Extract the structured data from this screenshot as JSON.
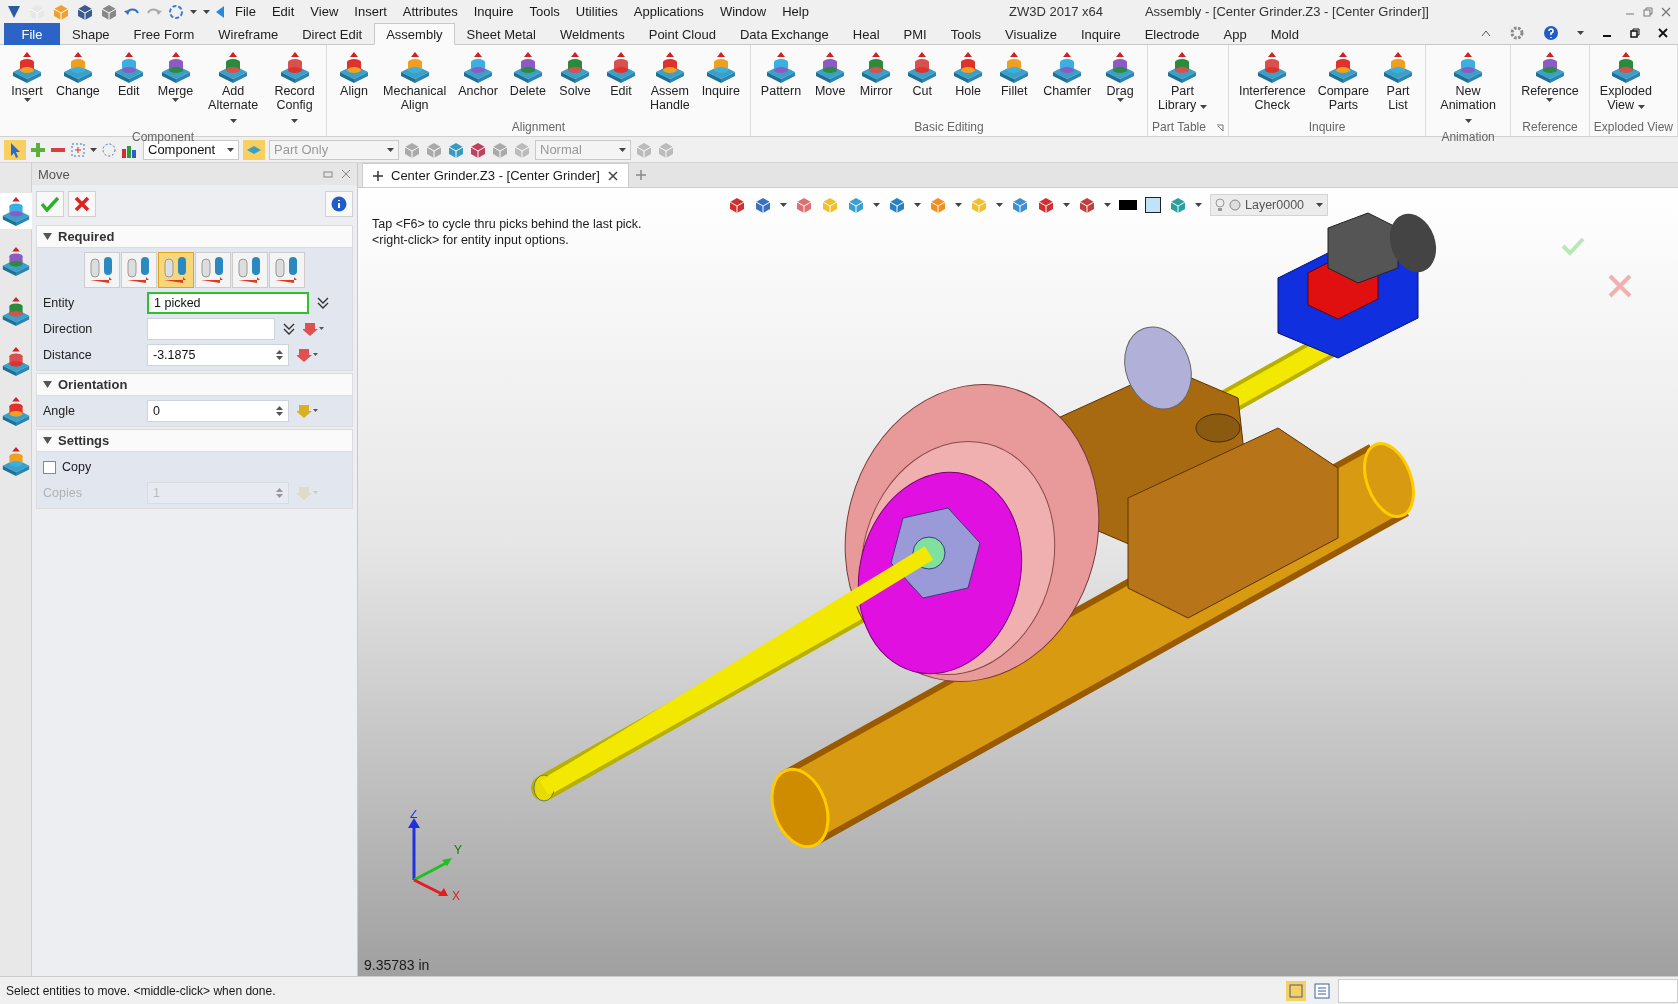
{
  "window": {
    "app": "ZW3D 2017  x64",
    "title": "Assembly - [Center Grinder.Z3 - [Center Grinder]]"
  },
  "menu": [
    "File",
    "Edit",
    "View",
    "Insert",
    "Attributes",
    "Inquire",
    "Tools",
    "Utilities",
    "Applications",
    "Window",
    "Help"
  ],
  "ribbon_tabs": [
    {
      "label": "File",
      "selected": false,
      "kind": "file"
    },
    {
      "label": "Shape",
      "selected": false,
      "kind": "tab"
    },
    {
      "label": "Free Form",
      "selected": false,
      "kind": "tab"
    },
    {
      "label": "Wireframe",
      "selected": false,
      "kind": "tab"
    },
    {
      "label": "Direct Edit",
      "selected": false,
      "kind": "tab"
    },
    {
      "label": "Assembly",
      "selected": true,
      "kind": "tab"
    },
    {
      "label": "Sheet Metal",
      "selected": false,
      "kind": "tab"
    },
    {
      "label": "Weldments",
      "selected": false,
      "kind": "tab"
    },
    {
      "label": "Point Cloud",
      "selected": false,
      "kind": "tab"
    },
    {
      "label": "Data Exchange",
      "selected": false,
      "kind": "tab"
    },
    {
      "label": "Heal",
      "selected": false,
      "kind": "tab"
    },
    {
      "label": "PMI",
      "selected": false,
      "kind": "tab"
    },
    {
      "label": "Tools",
      "selected": false,
      "kind": "tab"
    },
    {
      "label": "Visualize",
      "selected": false,
      "kind": "tab"
    },
    {
      "label": "Inquire",
      "selected": false,
      "kind": "tab"
    },
    {
      "label": "Electrode",
      "selected": false,
      "kind": "tab"
    },
    {
      "label": "App",
      "selected": false,
      "kind": "tab"
    },
    {
      "label": "Mold",
      "selected": false,
      "kind": "tab"
    }
  ],
  "ribbon_groups": [
    {
      "label": "Component",
      "launcher": false,
      "buttons": [
        {
          "label": "Insert",
          "menu": true
        },
        {
          "label": "Change",
          "menu": false
        },
        {
          "label": "Edit",
          "menu": false
        },
        {
          "label": "Merge",
          "menu": true
        },
        {
          "label": "Add\nAlternate",
          "menu": true
        },
        {
          "label": "Record\nConfig",
          "menu": true
        }
      ]
    },
    {
      "label": "Alignment",
      "launcher": false,
      "buttons": [
        {
          "label": "Align",
          "menu": false
        },
        {
          "label": "Mechanical\nAlign",
          "menu": false
        },
        {
          "label": "Anchor",
          "menu": false
        },
        {
          "label": "Delete",
          "menu": false
        },
        {
          "label": "Solve",
          "menu": false
        },
        {
          "label": "Edit",
          "menu": false
        },
        {
          "label": "Assem\nHandle",
          "menu": false
        },
        {
          "label": "Inquire",
          "menu": false
        }
      ]
    },
    {
      "label": "Basic Editing",
      "launcher": false,
      "buttons": [
        {
          "label": "Pattern",
          "menu": false
        },
        {
          "label": "Move",
          "menu": false
        },
        {
          "label": "Mirror",
          "menu": false
        },
        {
          "label": "Cut",
          "menu": false
        },
        {
          "label": "Hole",
          "menu": false
        },
        {
          "label": "Fillet",
          "menu": false
        },
        {
          "label": "Chamfer",
          "menu": false
        },
        {
          "label": "Drag",
          "menu": true
        }
      ]
    },
    {
      "label": "Part Table",
      "launcher": true,
      "buttons": [
        {
          "label": "Part\nLibrary",
          "menu": true
        }
      ]
    },
    {
      "label": "Inquire",
      "launcher": false,
      "buttons": [
        {
          "label": "Interference\nCheck",
          "menu": false
        },
        {
          "label": "Compare\nParts",
          "menu": false
        },
        {
          "label": "Part\nList",
          "menu": false
        }
      ]
    },
    {
      "label": "Animation",
      "launcher": false,
      "buttons": [
        {
          "label": "New\nAnimation",
          "menu": true
        }
      ]
    },
    {
      "label": "Reference",
      "launcher": false,
      "buttons": [
        {
          "label": "Reference",
          "menu": true
        }
      ]
    },
    {
      "label": "Exploded View",
      "launcher": false,
      "buttons": [
        {
          "label": "Exploded\nView",
          "menu": true
        }
      ]
    }
  ],
  "toolbar": {
    "filter": {
      "value": "Component",
      "disabled": false
    },
    "scope": {
      "value": "Part Only",
      "disabled": true
    },
    "mode": {
      "value": "Normal",
      "disabled": true
    }
  },
  "side_tabs": [
    {
      "selected": true
    },
    {
      "selected": false
    },
    {
      "selected": false
    },
    {
      "selected": false
    },
    {
      "selected": false
    },
    {
      "selected": false
    }
  ],
  "panel": {
    "title": "Move",
    "sections": [
      {
        "title": "Required",
        "expanded": true,
        "methods": [
          {
            "selected": false
          },
          {
            "selected": false
          },
          {
            "selected": true
          },
          {
            "selected": false
          },
          {
            "selected": false
          },
          {
            "selected": false
          }
        ],
        "rows": [
          {
            "kind": "entity",
            "label": "Entity",
            "value": "1 picked",
            "active": true,
            "disabled": false
          },
          {
            "kind": "direction",
            "label": "Direction",
            "active": false,
            "disabled": false
          },
          {
            "kind": "number",
            "label": "Distance",
            "value": "-3.1875",
            "active": false,
            "disabled": false
          }
        ]
      },
      {
        "title": "Orientation",
        "expanded": true,
        "rows": [
          {
            "kind": "number",
            "label": "Angle",
            "value": "0",
            "active": false,
            "disabled": false
          }
        ]
      },
      {
        "title": "Settings",
        "expanded": true,
        "rows": [
          {
            "kind": "checkbox",
            "label": "Copy",
            "checked": false,
            "disabled": false
          },
          {
            "kind": "number",
            "label": "Copies",
            "value": "1",
            "active": false,
            "disabled": true
          }
        ]
      }
    ]
  },
  "viewport": {
    "doc_tab": "Center Grinder.Z3 - [Center Grinder]",
    "hint": [
      "Tap <F6> to cycle thru picks behind the last pick.",
      "<right-click> for entity input options."
    ],
    "layer": "Layer0000",
    "axes": [
      "X",
      "Y",
      "Z"
    ],
    "measure": "9.35783 in"
  },
  "status_bar": "Select entities to move.  <middle-click> when done."
}
